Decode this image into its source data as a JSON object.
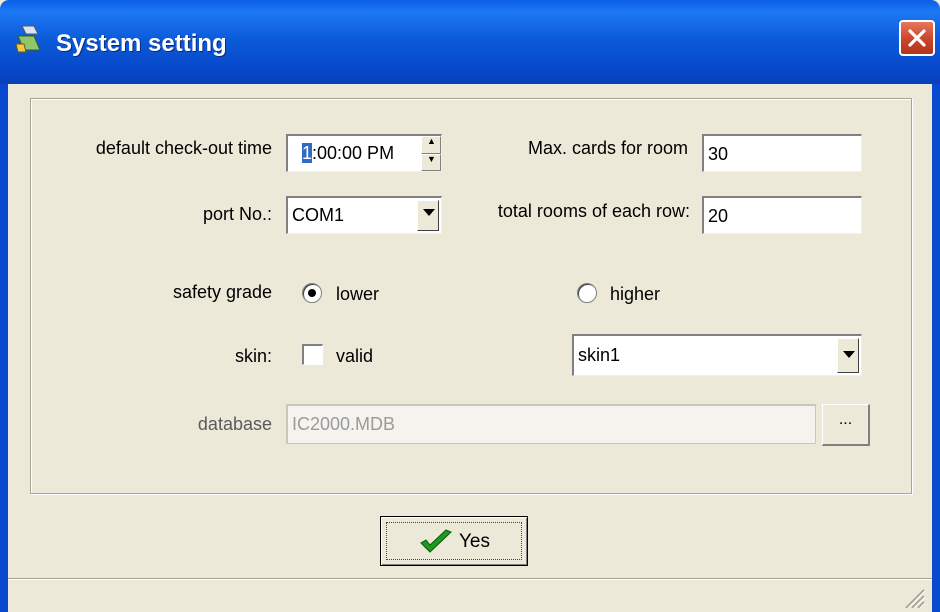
{
  "window": {
    "title": "System setting",
    "icons": {
      "app": "app-icon",
      "close": "close-icon"
    }
  },
  "form": {
    "checkout_label": "default check-out time",
    "checkout_hour": "1",
    "checkout_rest": ":00:00 PM",
    "port_label": "port No.:",
    "port_value": "COM1",
    "max_cards_label": "Max. cards for room",
    "max_cards_value": "30",
    "rooms_row_label": "total rooms of each row:",
    "rooms_row_value": "20",
    "safety_label": "safety grade",
    "safety_lower": "lower",
    "safety_higher": "higher",
    "safety_selected": "lower",
    "skin_label": "skin:",
    "skin_valid": "valid",
    "skin_valid_checked": false,
    "skin_value": "skin1",
    "database_label": "database",
    "database_value": "IC2000.MDB",
    "browse_label": "..."
  },
  "actions": {
    "yes_label": "Yes"
  },
  "colors": {
    "title_bar": "#0a5fe6",
    "dialog_bg": "#ece9d8",
    "close_button": "#c9452a",
    "check_green": "#1e9a1e"
  }
}
